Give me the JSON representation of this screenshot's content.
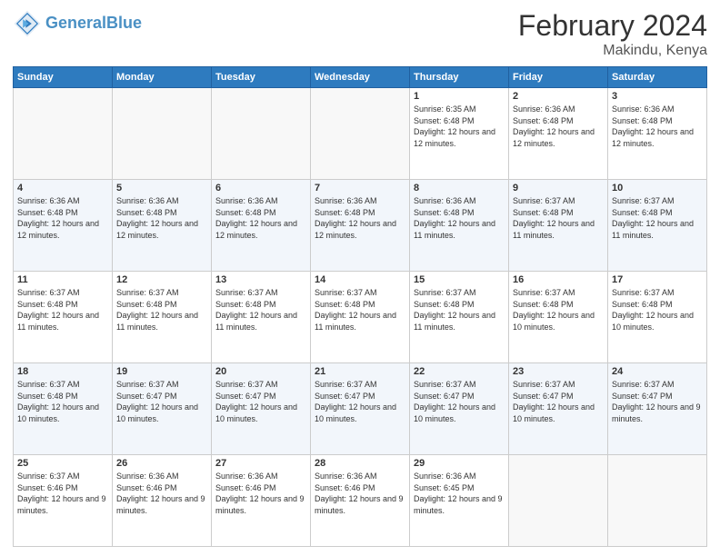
{
  "header": {
    "logo_line1": "General",
    "logo_line2": "Blue",
    "title": "February 2024",
    "subtitle": "Makindu, Kenya"
  },
  "days_of_week": [
    "Sunday",
    "Monday",
    "Tuesday",
    "Wednesday",
    "Thursday",
    "Friday",
    "Saturday"
  ],
  "weeks": [
    [
      {
        "day": "",
        "info": ""
      },
      {
        "day": "",
        "info": ""
      },
      {
        "day": "",
        "info": ""
      },
      {
        "day": "",
        "info": ""
      },
      {
        "day": "1",
        "info": "Sunrise: 6:35 AM\nSunset: 6:48 PM\nDaylight: 12 hours and 12 minutes."
      },
      {
        "day": "2",
        "info": "Sunrise: 6:36 AM\nSunset: 6:48 PM\nDaylight: 12 hours and 12 minutes."
      },
      {
        "day": "3",
        "info": "Sunrise: 6:36 AM\nSunset: 6:48 PM\nDaylight: 12 hours and 12 minutes."
      }
    ],
    [
      {
        "day": "4",
        "info": "Sunrise: 6:36 AM\nSunset: 6:48 PM\nDaylight: 12 hours and 12 minutes."
      },
      {
        "day": "5",
        "info": "Sunrise: 6:36 AM\nSunset: 6:48 PM\nDaylight: 12 hours and 12 minutes."
      },
      {
        "day": "6",
        "info": "Sunrise: 6:36 AM\nSunset: 6:48 PM\nDaylight: 12 hours and 12 minutes."
      },
      {
        "day": "7",
        "info": "Sunrise: 6:36 AM\nSunset: 6:48 PM\nDaylight: 12 hours and 12 minutes."
      },
      {
        "day": "8",
        "info": "Sunrise: 6:36 AM\nSunset: 6:48 PM\nDaylight: 12 hours and 11 minutes."
      },
      {
        "day": "9",
        "info": "Sunrise: 6:37 AM\nSunset: 6:48 PM\nDaylight: 12 hours and 11 minutes."
      },
      {
        "day": "10",
        "info": "Sunrise: 6:37 AM\nSunset: 6:48 PM\nDaylight: 12 hours and 11 minutes."
      }
    ],
    [
      {
        "day": "11",
        "info": "Sunrise: 6:37 AM\nSunset: 6:48 PM\nDaylight: 12 hours and 11 minutes."
      },
      {
        "day": "12",
        "info": "Sunrise: 6:37 AM\nSunset: 6:48 PM\nDaylight: 12 hours and 11 minutes."
      },
      {
        "day": "13",
        "info": "Sunrise: 6:37 AM\nSunset: 6:48 PM\nDaylight: 12 hours and 11 minutes."
      },
      {
        "day": "14",
        "info": "Sunrise: 6:37 AM\nSunset: 6:48 PM\nDaylight: 12 hours and 11 minutes."
      },
      {
        "day": "15",
        "info": "Sunrise: 6:37 AM\nSunset: 6:48 PM\nDaylight: 12 hours and 11 minutes."
      },
      {
        "day": "16",
        "info": "Sunrise: 6:37 AM\nSunset: 6:48 PM\nDaylight: 12 hours and 10 minutes."
      },
      {
        "day": "17",
        "info": "Sunrise: 6:37 AM\nSunset: 6:48 PM\nDaylight: 12 hours and 10 minutes."
      }
    ],
    [
      {
        "day": "18",
        "info": "Sunrise: 6:37 AM\nSunset: 6:48 PM\nDaylight: 12 hours and 10 minutes."
      },
      {
        "day": "19",
        "info": "Sunrise: 6:37 AM\nSunset: 6:47 PM\nDaylight: 12 hours and 10 minutes."
      },
      {
        "day": "20",
        "info": "Sunrise: 6:37 AM\nSunset: 6:47 PM\nDaylight: 12 hours and 10 minutes."
      },
      {
        "day": "21",
        "info": "Sunrise: 6:37 AM\nSunset: 6:47 PM\nDaylight: 12 hours and 10 minutes."
      },
      {
        "day": "22",
        "info": "Sunrise: 6:37 AM\nSunset: 6:47 PM\nDaylight: 12 hours and 10 minutes."
      },
      {
        "day": "23",
        "info": "Sunrise: 6:37 AM\nSunset: 6:47 PM\nDaylight: 12 hours and 10 minutes."
      },
      {
        "day": "24",
        "info": "Sunrise: 6:37 AM\nSunset: 6:47 PM\nDaylight: 12 hours and 9 minutes."
      }
    ],
    [
      {
        "day": "25",
        "info": "Sunrise: 6:37 AM\nSunset: 6:46 PM\nDaylight: 12 hours and 9 minutes."
      },
      {
        "day": "26",
        "info": "Sunrise: 6:36 AM\nSunset: 6:46 PM\nDaylight: 12 hours and 9 minutes."
      },
      {
        "day": "27",
        "info": "Sunrise: 6:36 AM\nSunset: 6:46 PM\nDaylight: 12 hours and 9 minutes."
      },
      {
        "day": "28",
        "info": "Sunrise: 6:36 AM\nSunset: 6:46 PM\nDaylight: 12 hours and 9 minutes."
      },
      {
        "day": "29",
        "info": "Sunrise: 6:36 AM\nSunset: 6:45 PM\nDaylight: 12 hours and 9 minutes."
      },
      {
        "day": "",
        "info": ""
      },
      {
        "day": "",
        "info": ""
      }
    ]
  ]
}
